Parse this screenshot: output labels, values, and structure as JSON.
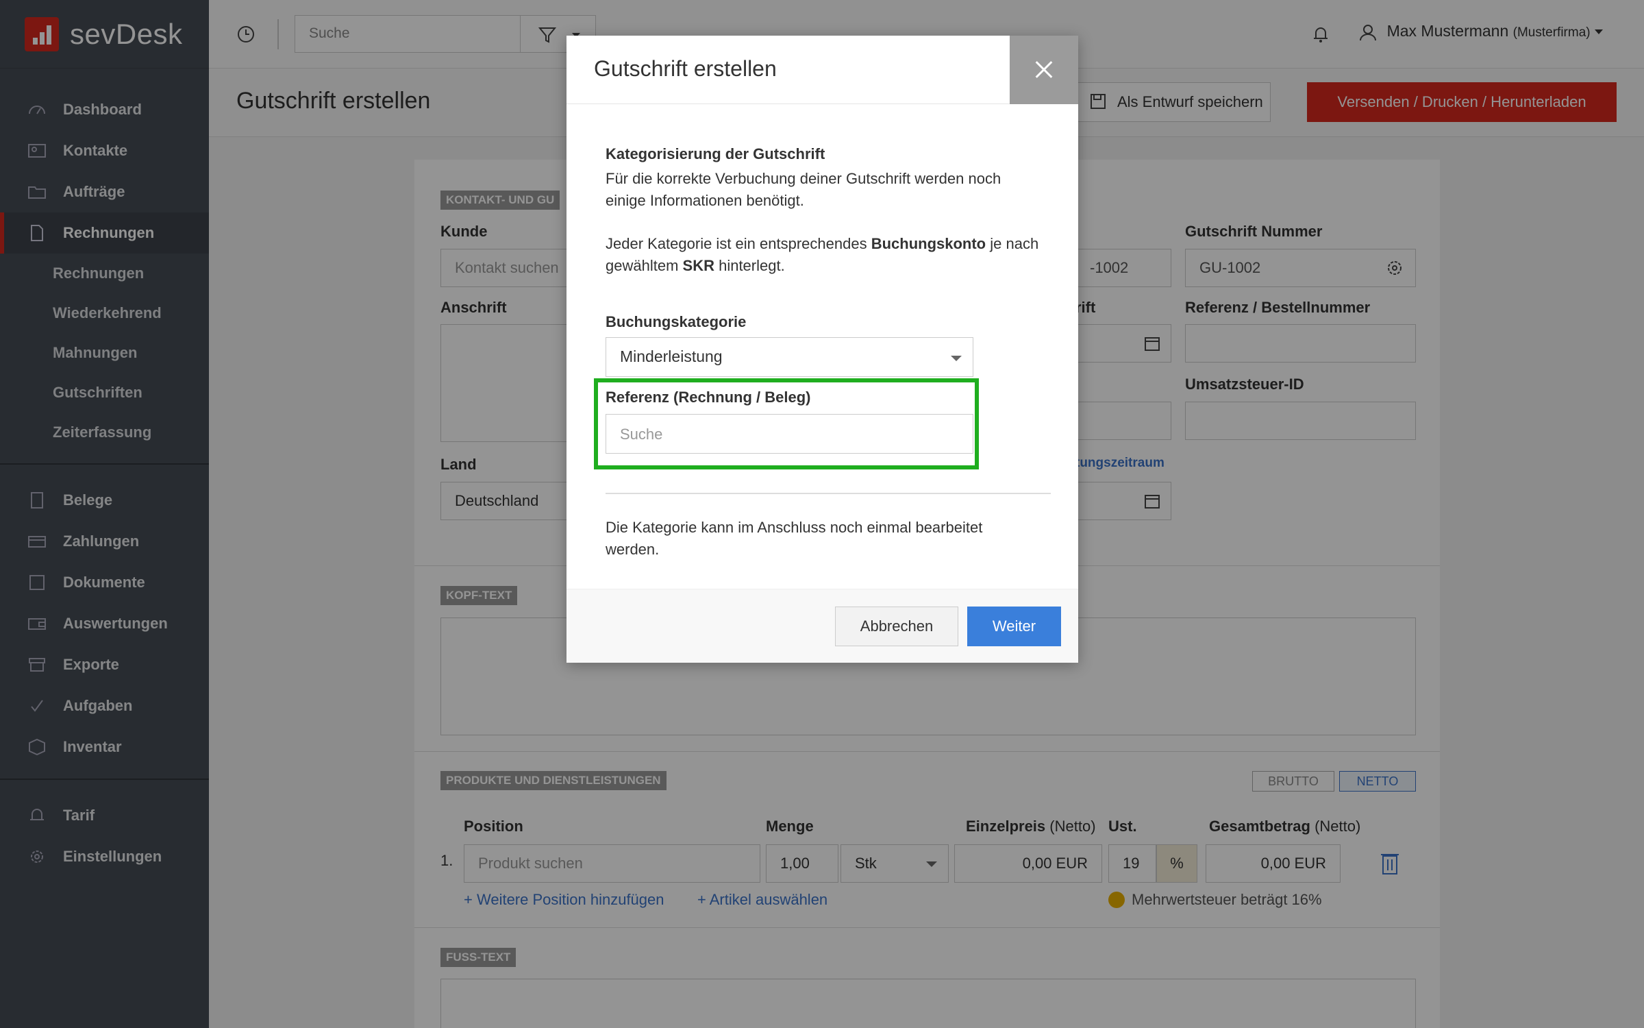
{
  "app": {
    "brand": "sevDesk",
    "accent": "#d6281e"
  },
  "sidebar": {
    "items": [
      {
        "label": "Dashboard",
        "icon": "dashboard-icon"
      },
      {
        "label": "Kontakte",
        "icon": "contacts-icon"
      },
      {
        "label": "Aufträge",
        "icon": "folder-icon"
      },
      {
        "label": "Rechnungen",
        "icon": "document-icon",
        "active": true
      }
    ],
    "sub_items": [
      "Rechnungen",
      "Wiederkehrend",
      "Mahnungen",
      "Gutschriften",
      "Zeiterfassung"
    ],
    "items2": [
      {
        "label": "Belege",
        "icon": "receipt-icon"
      },
      {
        "label": "Zahlungen",
        "icon": "card-icon"
      },
      {
        "label": "Dokumente",
        "icon": "file-icon"
      },
      {
        "label": "Auswertungen",
        "icon": "wallet-icon"
      },
      {
        "label": "Exporte",
        "icon": "archive-icon"
      },
      {
        "label": "Aufgaben",
        "icon": "check-icon"
      },
      {
        "label": "Inventar",
        "icon": "box-icon"
      }
    ],
    "items3": [
      {
        "label": "Tarif",
        "icon": "bell-icon"
      },
      {
        "label": "Einstellungen",
        "icon": "gear-icon"
      }
    ]
  },
  "topbar": {
    "search_placeholder": "Suche",
    "user_name": "Max Mustermann",
    "user_company": "(Musterfirma)"
  },
  "header": {
    "title": "Gutschrift erstellen",
    "draft_label": "Als Entwurf speichern",
    "send_label": "Versenden / Drucken / Herunterladen"
  },
  "form": {
    "section_contact": "KONTAKT- UND GU",
    "kunde_label": "Kunde",
    "kunde_placeholder": "Kontakt suchen",
    "anschrift_label": "Anschrift",
    "land_label": "Land",
    "land_value": "Deutschland",
    "nummer_partial_value": "-1002",
    "datum_partial_label": "rift",
    "leistung_link_partial": "tungszeitraum",
    "gs_nummer_label": "Gutschrift Nummer",
    "gs_nummer_value": "GU-1002",
    "referenz_label": "Referenz / Bestellnummer",
    "ust_id_label": "Umsatzsteuer-ID",
    "section_kopf": "KOPF-TEXT",
    "section_produkte": "PRODUKTE UND DIENSTLEISTUNGEN",
    "brutto": "BRUTTO",
    "netto": "NETTO",
    "col_position": "Position",
    "col_menge": "Menge",
    "col_einzelpreis": "Einzelpreis",
    "col_einzelpreis_suffix": "(Netto)",
    "col_ust": "Ust.",
    "col_gesamt": "Gesamtbetrag",
    "col_gesamt_suffix": "(Netto)",
    "row_index": "1.",
    "produkt_placeholder": "Produkt suchen",
    "menge_value": "1,00",
    "unit_value": "Stk",
    "einzelpreis_value": "0,00 EUR",
    "ust_value": "19",
    "ust_unit": "%",
    "gesamt_value": "0,00 EUR",
    "add_position": "+ Weitere Position hinzufügen",
    "add_artikel": "+ Artikel auswählen",
    "mwst_hint": "Mehrwertsteuer beträgt 16%",
    "section_fuss": "FUSS-TEXT"
  },
  "modal": {
    "title": "Gutschrift erstellen",
    "intro_heading": "Kategorisierung der Gutschrift",
    "intro_text": "Für die korrekte Verbuchung deiner Gutschrift werden noch einige Informationen benötigt.",
    "info_pre": "Jeder Kategorie ist ein entsprechendes ",
    "info_bold1": "Buchungskonto",
    "info_mid": " je nach gewähltem ",
    "info_bold2": "SKR",
    "info_post": " hinterlegt.",
    "kategorie_label": "Buchungskategorie",
    "kategorie_value": "Minderleistung",
    "referenz_label": "Referenz (Rechnung / Beleg)",
    "referenz_placeholder": "Suche",
    "footer_note": "Die Kategorie kann im Anschluss noch einmal bearbeitet werden.",
    "cancel_label": "Abbrechen",
    "next_label": "Weiter"
  }
}
